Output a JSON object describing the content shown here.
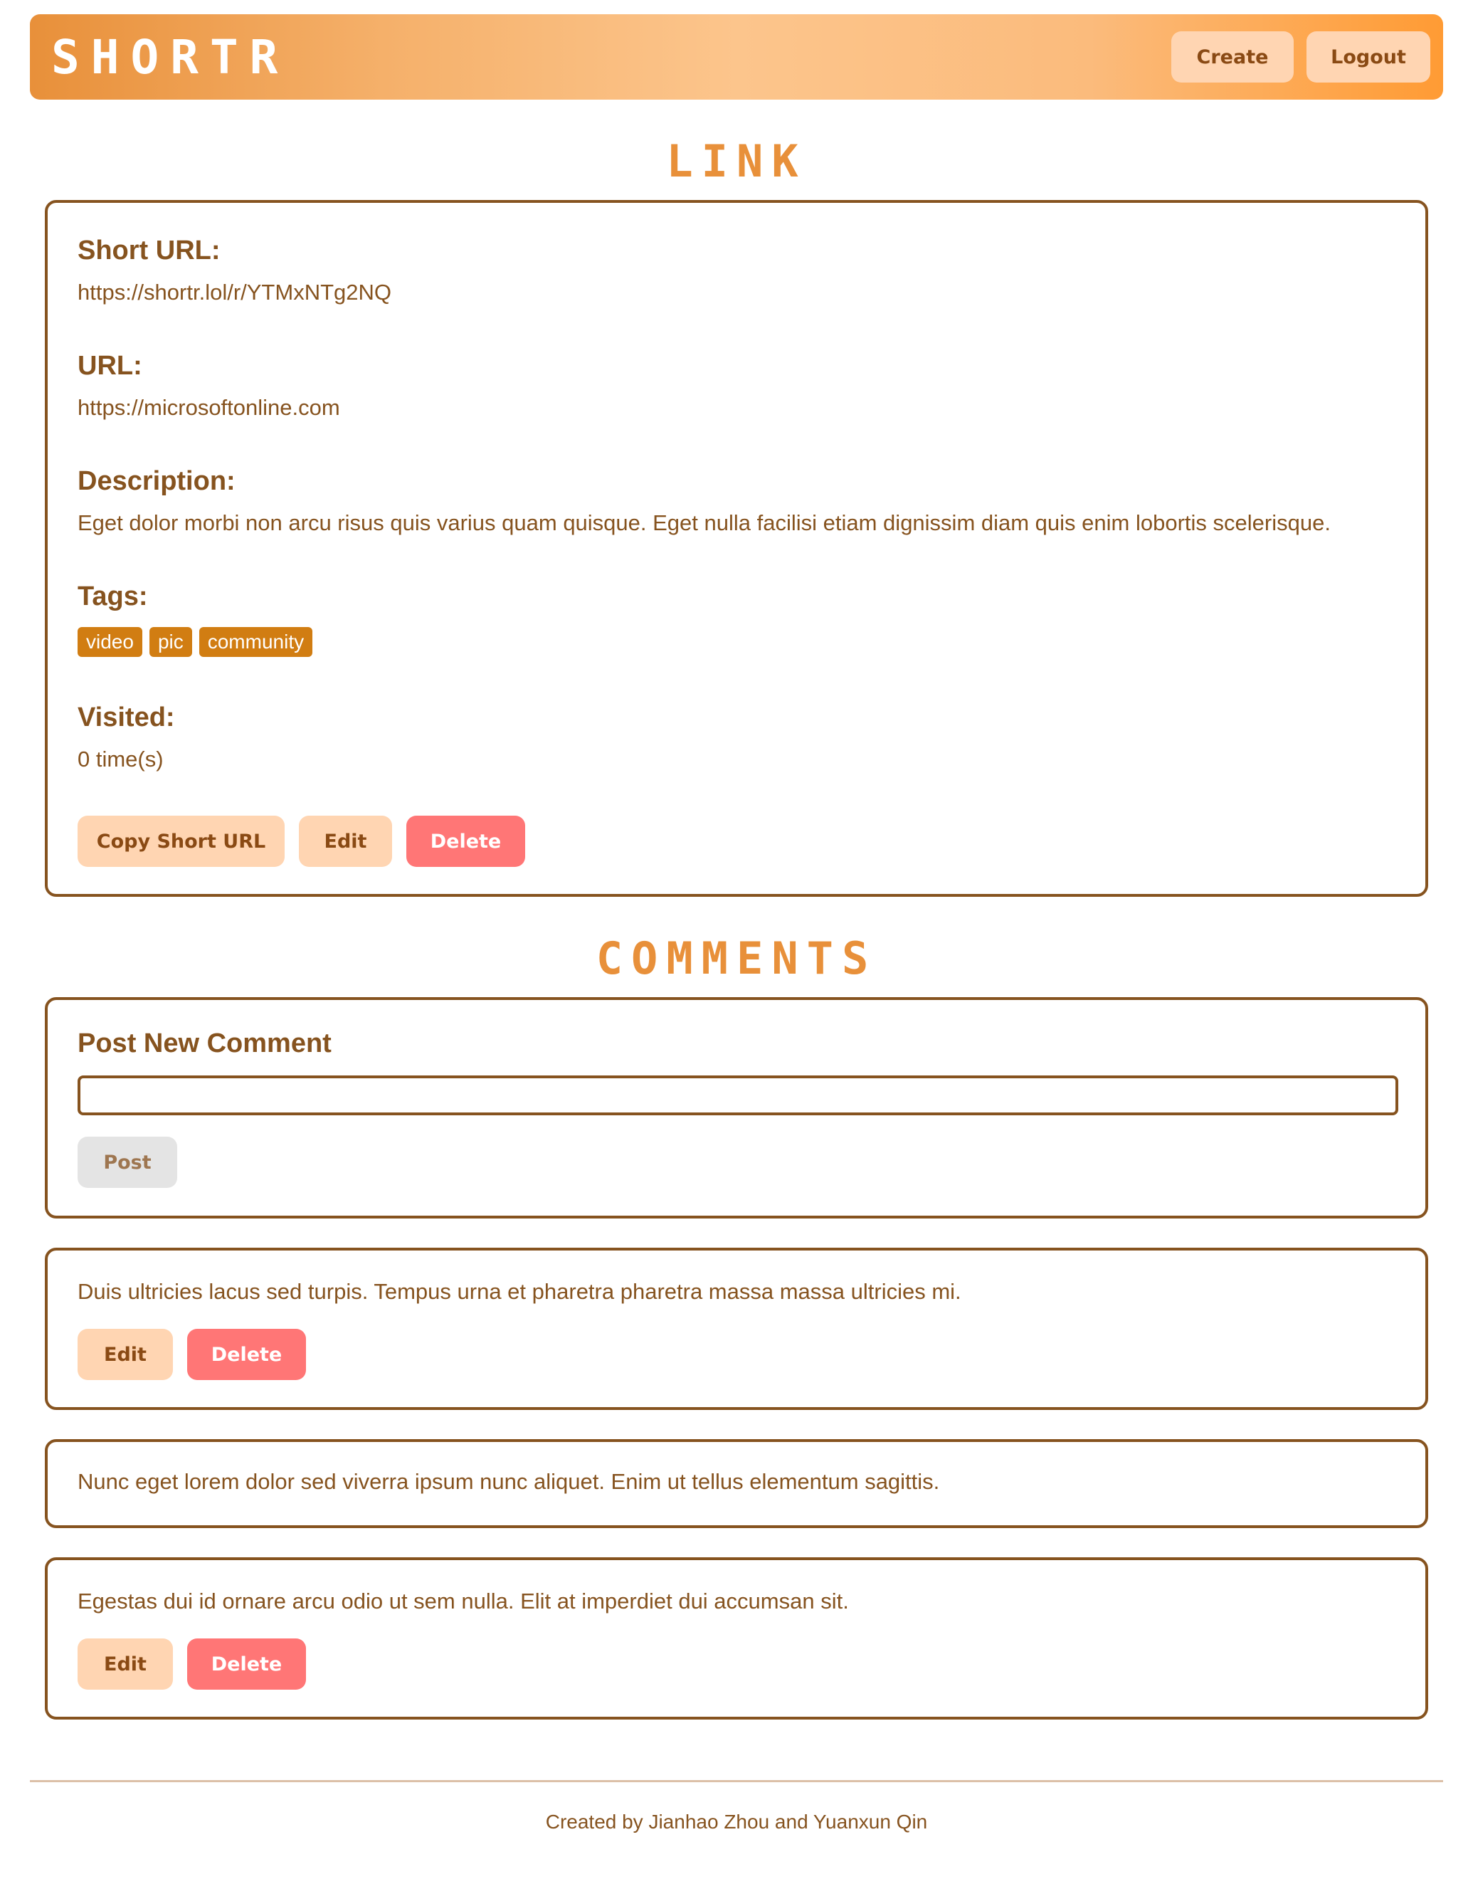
{
  "header": {
    "logo": "SHORTR",
    "create_label": "Create",
    "logout_label": "Logout"
  },
  "link_section": {
    "title": "LINK",
    "short_url_label": "Short URL:",
    "short_url": "https://shortr.lol/r/YTMxNTg2NQ",
    "url_label": "URL:",
    "url": "https://microsoftonline.com",
    "description_label": "Description:",
    "description": "Eget dolor morbi non arcu risus quis varius quam quisque. Eget nulla facilisi etiam dignissim diam quis enim lobortis scelerisque.",
    "tags_label": "Tags:",
    "tags": [
      "video",
      "pic",
      "community"
    ],
    "visited_label": "Visited:",
    "visited": "0 time(s)",
    "copy_label": "Copy Short URL",
    "edit_label": "Edit",
    "delete_label": "Delete"
  },
  "comments_section": {
    "title": "COMMENTS",
    "new_comment_heading": "Post New Comment",
    "new_comment_value": "",
    "post_label": "Post",
    "comments": [
      {
        "text": "Duis ultricies lacus sed turpis. Tempus urna et pharetra pharetra massa massa ultricies mi.",
        "edit_label": "Edit",
        "delete_label": "Delete"
      },
      {
        "text": "Nunc eget lorem dolor sed viverra ipsum nunc aliquet. Enim ut tellus elementum sagittis."
      },
      {
        "text": "Egestas dui id ornare arcu odio ut sem nulla. Elit at imperdiet dui accumsan sit.",
        "edit_label": "Edit",
        "delete_label": "Delete"
      }
    ]
  },
  "footer": {
    "text": "Created by Jianhao Zhou and Yuanxun Qin"
  },
  "colors": {
    "accent": "#e8903a",
    "text_brown": "#86531f",
    "tag_bg": "#d17d12",
    "button_peach": "#ffd5b2",
    "button_red": "#ff7676"
  }
}
